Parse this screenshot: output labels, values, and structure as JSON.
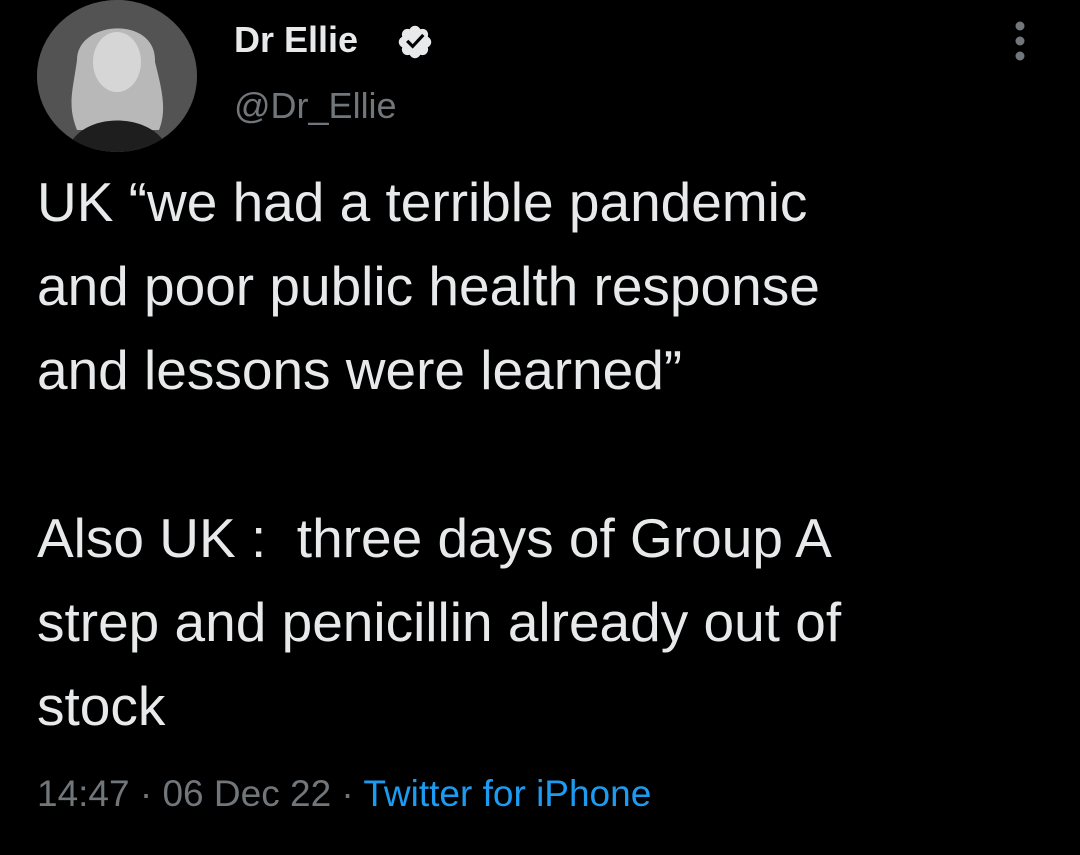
{
  "author": {
    "display_name": "Dr Ellie",
    "handle": "@Dr_Ellie",
    "verified_icon": "verified-badge-icon",
    "avatar": "profile-photo"
  },
  "tweet": {
    "text": "UK “we had a terrible pandemic\nand poor public health response\nand lessons were learned”\n\nAlso UK :  three days of Group A\nstrep and penicillin already out of\nstock"
  },
  "meta": {
    "time": "14:47",
    "separator1": " · ",
    "date": "06 Dec 22",
    "separator2": " · ",
    "source": "Twitter for iPhone"
  },
  "actions": {
    "more_icon": "more-vertical-icon"
  },
  "colors": {
    "background": "#000000",
    "text": "#e7e9ea",
    "muted": "#71767b",
    "accent": "#1d9bf0"
  }
}
